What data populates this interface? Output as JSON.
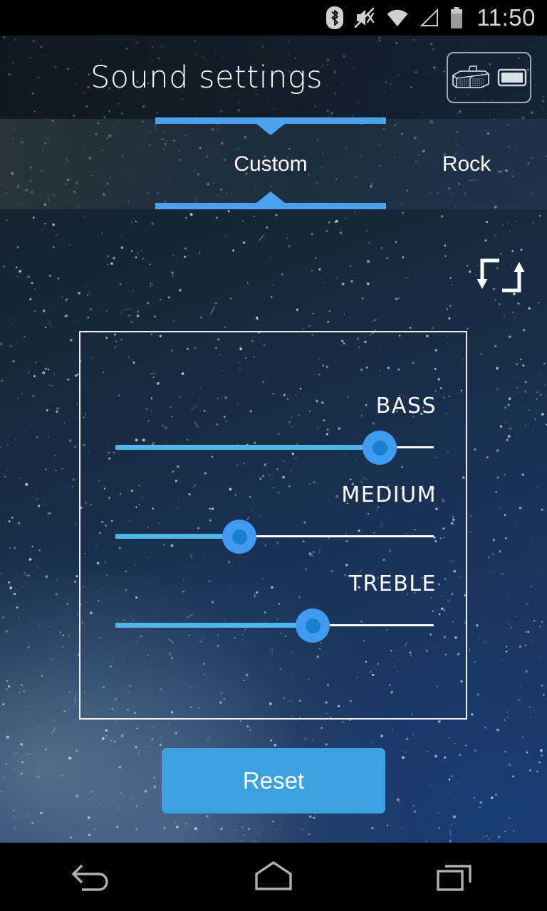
{
  "statusbar": {
    "time": "11:50",
    "icons": [
      {
        "name": "bluetooth-icon"
      },
      {
        "name": "sound-muted-icon"
      },
      {
        "name": "wifi-icon"
      },
      {
        "name": "cellular-signal-icon"
      },
      {
        "name": "battery-icon"
      }
    ]
  },
  "header": {
    "title": "Sound settings",
    "device_button": {
      "name": "audio-output-device-button",
      "icons": [
        "soundbar-icon",
        "display-device-icon"
      ]
    }
  },
  "tabs": {
    "selected_index": 0,
    "items": [
      {
        "label": "Custom",
        "selected": true
      },
      {
        "label": "Rock",
        "selected": false
      }
    ]
  },
  "toolbar": {
    "loop_icon": "loop-repeat-icon"
  },
  "equalizer": {
    "sliders": [
      {
        "label": "BASS",
        "value": 83,
        "min": 0,
        "max": 100
      },
      {
        "label": "MEDIUM",
        "value": 39,
        "min": 0,
        "max": 100
      },
      {
        "label": "TREBLE",
        "value": 62,
        "min": 0,
        "max": 100
      }
    ]
  },
  "actions": {
    "reset_label": "Reset"
  },
  "navbar": {
    "items": [
      {
        "name": "nav-back-button",
        "label": "Back"
      },
      {
        "name": "nav-home-button",
        "label": "Home"
      },
      {
        "name": "nav-recents-button",
        "label": "Recents"
      }
    ]
  },
  "colors": {
    "accent": "#4ba3f0",
    "track_active": "#4db8e8",
    "thumb": "#3f9bf0",
    "thumb_inner": "#1a7fcc",
    "button": "#3ba1e0",
    "text": "#ffffff"
  }
}
